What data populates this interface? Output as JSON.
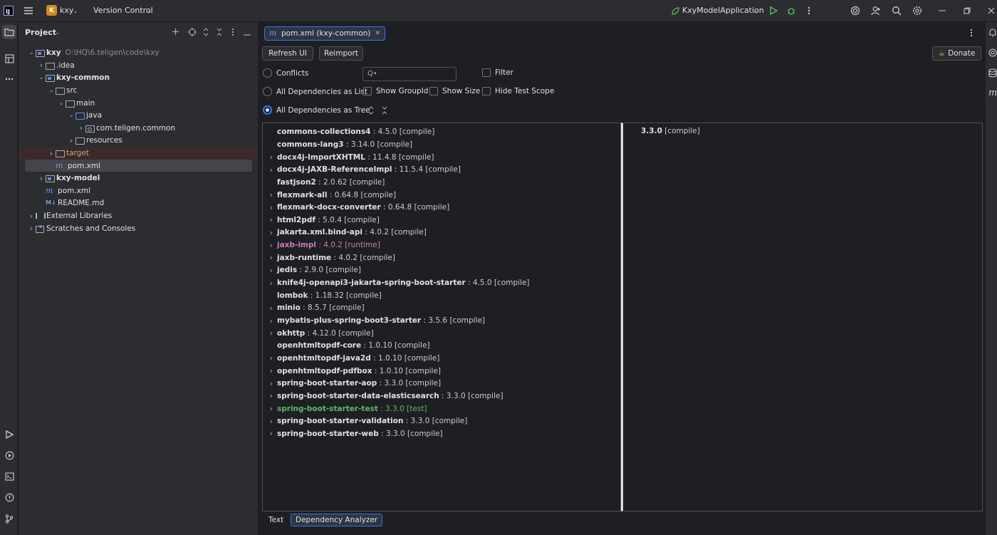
{
  "titlebar": {
    "project_badge": "K",
    "project_name": "kxy",
    "vcs_label": "Version Control",
    "run_config": "KxyModelApplication"
  },
  "project_panel": {
    "title": "Project",
    "tree": [
      {
        "label": "kxy",
        "path": "O:\\HQ\\6.teligen\\code\\kxy",
        "icon": "module-icon",
        "bold": true,
        "depth": 0,
        "expanded": true
      },
      {
        "label": ".idea",
        "icon": "folder-icon",
        "depth": 1,
        "expanded": false
      },
      {
        "label": "kxy-common",
        "icon": "module-icon",
        "bold": true,
        "depth": 1,
        "expanded": true
      },
      {
        "label": "src",
        "icon": "folder-icon",
        "depth": 2,
        "expanded": true
      },
      {
        "label": "main",
        "icon": "folder-icon",
        "depth": 3,
        "expanded": true
      },
      {
        "label": "java",
        "icon": "source-folder-icon",
        "depth": 4,
        "expanded": true
      },
      {
        "label": "com.teligen.common",
        "icon": "package-icon",
        "depth": 5,
        "expanded": false
      },
      {
        "label": "resources",
        "icon": "resources-folder-icon",
        "depth": 4,
        "expanded": false
      },
      {
        "label": "target",
        "icon": "folder-icon",
        "depth": 2,
        "expanded": false,
        "excluded": true
      },
      {
        "label": "pom.xml",
        "icon": "maven-icon",
        "depth": 2,
        "selected": true
      },
      {
        "label": "kxy-model",
        "icon": "module-icon",
        "bold": true,
        "depth": 1,
        "expanded": false
      },
      {
        "label": "pom.xml",
        "icon": "maven-icon",
        "depth": 1
      },
      {
        "label": "README.md",
        "icon": "markdown-icon",
        "depth": 1
      },
      {
        "label": "External Libraries",
        "icon": "library-icon",
        "depth": 0,
        "expanded": false
      },
      {
        "label": "Scratches and Consoles",
        "icon": "scratch-icon",
        "depth": 0,
        "expanded": false
      }
    ]
  },
  "editor": {
    "tab_label": "pom.xml (kxy-common)",
    "refresh_label": "Refresh UI",
    "reimport_label": "Reimport",
    "donate_label": "Donate",
    "conflicts_label": "Conflicts",
    "search_placeholder": "Q•",
    "filter_label": "Filter",
    "list_label": "All Dependencies as List",
    "show_groupid_label": "Show GroupId",
    "show_size_label": "Show Size",
    "hide_test_label": "Hide Test Scope",
    "tree_label": "All Dependencies as Tree",
    "detail_version": "3.3.0",
    "detail_scope": "[compile]",
    "bottom_tabs": [
      "Text",
      "Dependency Analyzer"
    ]
  },
  "dependencies": [
    {
      "name": "commons-collections4",
      "version": ": 4.5.0 [compile]",
      "expandable": false
    },
    {
      "name": "commons-lang3",
      "version": ": 3.14.0 [compile]",
      "expandable": false
    },
    {
      "name": "docx4j-ImportXHTML",
      "version": ": 11.4.8 [compile]",
      "expandable": true
    },
    {
      "name": "docx4j-JAXB-ReferenceImpl",
      "version": ": 11.5.4 [compile]",
      "expandable": true
    },
    {
      "name": "fastjson2",
      "version": ": 2.0.62 [compile]",
      "expandable": false
    },
    {
      "name": "flexmark-all",
      "version": ": 0.64.8 [compile]",
      "expandable": true
    },
    {
      "name": "flexmark-docx-converter",
      "version": ": 0.64.8 [compile]",
      "expandable": true
    },
    {
      "name": "html2pdf",
      "version": ": 5.0.4 [compile]",
      "expandable": true
    },
    {
      "name": "jakarta.xml.bind-api",
      "version": ": 4.0.2 [compile]",
      "expandable": true
    },
    {
      "name": "jaxb-impl",
      "version": ": 4.0.2 [runtime]",
      "expandable": true,
      "scope": "runtime"
    },
    {
      "name": "jaxb-runtime",
      "version": ": 4.0.2 [compile]",
      "expandable": true
    },
    {
      "name": "jedis",
      "version": ": 2.9.0 [compile]",
      "expandable": true
    },
    {
      "name": "knife4j-openapi3-jakarta-spring-boot-starter",
      "version": ": 4.5.0 [compile]",
      "expandable": true
    },
    {
      "name": "lombok",
      "version": ": 1.18.32 [compile]",
      "expandable": false
    },
    {
      "name": "minio",
      "version": ": 8.5.7 [compile]",
      "expandable": true
    },
    {
      "name": "mybatis-plus-spring-boot3-starter",
      "version": ": 3.5.6 [compile]",
      "expandable": true
    },
    {
      "name": "okhttp",
      "version": ": 4.12.0 [compile]",
      "expandable": true
    },
    {
      "name": "openhtmltopdf-core",
      "version": ": 1.0.10 [compile]",
      "expandable": false
    },
    {
      "name": "openhtmltopdf-java2d",
      "version": ": 1.0.10 [compile]",
      "expandable": true
    },
    {
      "name": "openhtmltopdf-pdfbox",
      "version": ": 1.0.10 [compile]",
      "expandable": true
    },
    {
      "name": "spring-boot-starter-aop",
      "version": ": 3.3.0 [compile]",
      "expandable": true
    },
    {
      "name": "spring-boot-starter-data-elasticsearch",
      "version": ": 3.3.0 [compile]",
      "expandable": true
    },
    {
      "name": "spring-boot-starter-test",
      "version": ": 3.3.0 [test]",
      "expandable": true,
      "scope": "test"
    },
    {
      "name": "spring-boot-starter-validation",
      "version": ": 3.3.0 [compile]",
      "expandable": true
    },
    {
      "name": "spring-boot-starter-web",
      "version": ": 3.3.0 [compile]",
      "expandable": true
    }
  ],
  "colors": {
    "accent": "#3574f0",
    "runtime_scope": "#c77dbb",
    "test_scope": "#5fb865"
  }
}
